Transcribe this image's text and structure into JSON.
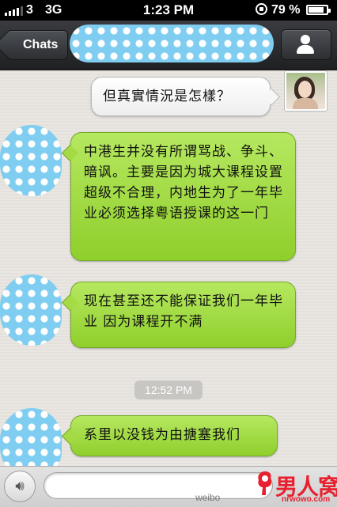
{
  "status_bar": {
    "carrier": "3",
    "network": "3G",
    "time": "1:23 PM",
    "battery": "79 %",
    "battery_level": 0.79
  },
  "nav": {
    "back_label": "Chats"
  },
  "messages": [
    {
      "side": "right",
      "text": "但真實情況是怎樣？"
    },
    {
      "side": "left",
      "text": "中港生并没有所谓骂战、争斗、暗讽。主要是因为城大课程设置超级不合理，内地生为了一年毕业必须选择粤语授课的这一门"
    },
    {
      "side": "left",
      "text": "现在甚至还不能保证我们一年毕业 因为课程开不满"
    },
    {
      "side": "left",
      "text": "系里以没钱为由搪塞我们"
    }
  ],
  "timestamp": "12:52 PM",
  "watermark": {
    "brand": "男人窝",
    "domain": "nrwowo.com",
    "weibo": "weibo"
  },
  "icons": {
    "voice": "speaker-icon",
    "profile": "person-icon"
  }
}
